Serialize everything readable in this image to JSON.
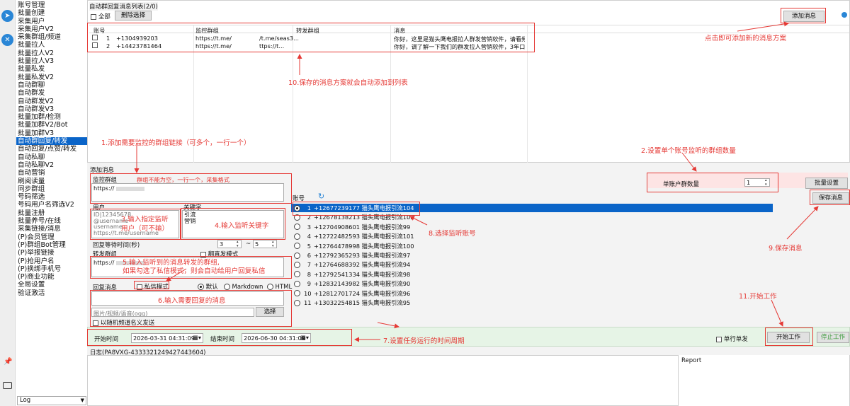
{
  "sidebar": {
    "items": [
      "账号管理",
      "批量创建",
      "采集用户",
      "采集用户V2",
      "采集群组/频道",
      "批量拉人",
      "批量拉人V2",
      "批量拉人V3",
      "批量私发",
      "批量私发V2",
      "自动群聊",
      "自动群发",
      "自动群发V2",
      "自动群发V3",
      "批量加群/检测",
      "批量加群V2/Bot",
      "批量加群V3",
      "自动群回复/转发",
      "自动回复/点赞/转发",
      "自动私聊",
      "自动私聊V2",
      "自动营销",
      "刷阅读量",
      "同步群组",
      "号码筛选",
      "号码用户名筛选V2",
      "批量注册",
      "批量养号/在线",
      "采集链接/消息",
      "(P)会员管理",
      "(P)群组Bot管理",
      "(P)举报链接",
      "(P)抢用户名",
      "(P)换绑手机号",
      "(P)商业功能",
      "全局设置",
      "验证激活"
    ],
    "active_index": 17,
    "log_select": "Log"
  },
  "list_panel": {
    "title": "自动群回复消息列表(2/0)",
    "select_all": "全部",
    "delete_selected": "删除选择",
    "add_message": "添加消息",
    "columns": [
      "账号",
      "监控群组",
      "转发群组",
      "消息"
    ],
    "rows": [
      {
        "index": "1",
        "account": "+13049392​03",
        "monitor": "https://t.me/",
        "monitor_tail": "/t.me/seas3...",
        "forward": "",
        "message": "你好，这里是猫头鹰电报拉人群发营销软件，请看频..."
      },
      {
        "index": "2",
        "account": "+14423781464",
        "monitor": "https://t.me/",
        "monitor_tail": "ttps://t...",
        "forward": "",
        "message": "你好，调了解一下我们的群发拉人营销软件，3年口..."
      }
    ]
  },
  "add_panel": {
    "title": "添加消息",
    "monitor_group_label": "监控群组",
    "monitor_group_hint": "群组不能为空，一行一个，采集格式",
    "monitor_group_value": "https://",
    "user_label": "用户",
    "user_lines": [
      "ID|12345678",
      "@username",
      "username",
      "https://t.me/username"
    ],
    "keyword_label": "关键字",
    "keyword_lines": [
      "引流",
      "营销"
    ],
    "wait_label": "回复等待时间(秒)",
    "wait_min": "3",
    "wait_sep": "~",
    "wait_max": "5",
    "forward_group_label": "转发群组",
    "random_send_label": "翻直发模式",
    "forward_group_value": "https://",
    "reply_label": "回复消息",
    "private_mode_label": "私信模式",
    "format_options": [
      "默认",
      "Markdown",
      "HTML"
    ],
    "media_placeholder": "图片/视频/语音(ogg)",
    "choose_button": "选择",
    "random_channel_label": "以随机频道名义发送"
  },
  "account_panel": {
    "header": "账号",
    "per_account_label": "单账户群数量",
    "per_account_value": "1",
    "batch_settings": "批量设置",
    "save_message": "保存消息",
    "accounts": [
      {
        "n": "1",
        "name": "+12677239177 猫头鹰电报引流104"
      },
      {
        "n": "2",
        "name": "+12678138213 猫头鹰电报引流102"
      },
      {
        "n": "3",
        "name": "+12704908601 猫头鹰电报引流99"
      },
      {
        "n": "4",
        "name": "+12722482593 猫头鹰电报引流101"
      },
      {
        "n": "5",
        "name": "+12764478998 猫头鹰电报引流100"
      },
      {
        "n": "6",
        "name": "+12792365293 猫头鹰电报引流97"
      },
      {
        "n": "7",
        "name": "+12764688392 猫头鹰电报引流94"
      },
      {
        "n": "8",
        "name": "+12792541334 猫头鹰电报引流98"
      },
      {
        "n": "9",
        "name": "+12832143982 猫头鹰电报引流90"
      },
      {
        "n": "10",
        "name": "+12812701724 猫头鹰电报引流96"
      },
      {
        "n": "11",
        "name": "+13032254815 猫头鹰电报引流95"
      }
    ]
  },
  "time_bar": {
    "start_label": "开始时间",
    "start_value": "2026-03-31 04:31:09",
    "end_label": "结束时间",
    "end_value": "2026-06-30 04:31:09",
    "single_line_label": "单行单发",
    "start_work": "开始工作",
    "stop_work": "停止工作"
  },
  "log": {
    "title": "日志(PA8VXG-4333321249427443604)",
    "report_label": "Report"
  },
  "annotations": {
    "a1": "1.添加需要监控的群组链接（可多个，一行一个）",
    "a2": "2.设置单个账号监听的群组数量",
    "a3": "3.输入指定监听用户（可不输）",
    "a4": "4.输入监听关键字",
    "a5": "5.输入监听到的消息转发的群组,\n如果勾选了私信模式，则会自动给用户回复私信",
    "a6": "6.输入需要回复的消息",
    "a7": "7.设置任务运行的时间周期",
    "a8": "8.选择监听账号",
    "a9": "9.保存消息",
    "a10": "10.保存的消息方案就会自动添加到列表",
    "a11": "11.开始工作",
    "a_add": "点击即可添加新的消息方案"
  },
  "colors": {
    "accent": "#0a64c8",
    "annotation": "#e53935",
    "time_bar_bg": "#e6f4e6"
  }
}
